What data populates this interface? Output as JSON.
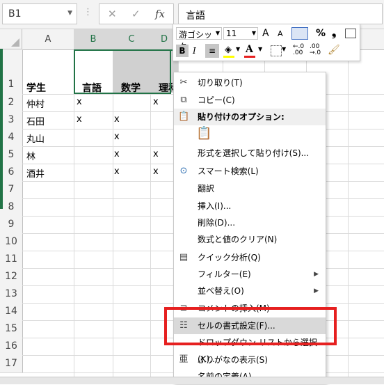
{
  "formula_bar": {
    "name_box": "B1",
    "dots": "⋮",
    "cancel_icon": "✕",
    "enter_icon": "✓",
    "fx_label": "fx",
    "content": "言語"
  },
  "columns": [
    "A",
    "B",
    "C",
    "D"
  ],
  "rows": [
    "1",
    "2",
    "3",
    "4",
    "5",
    "6",
    "7",
    "8",
    "9",
    "10",
    "11",
    "12",
    "13",
    "14",
    "15",
    "16",
    "17"
  ],
  "cells": {
    "A1": "学生",
    "B1": "言語",
    "C1": "数学",
    "D1": "理科",
    "A2": "仲村",
    "B2": "x",
    "D2": "x",
    "A3": "石田",
    "B3": "x",
    "C3": "x",
    "A4": "丸山",
    "C4": "x",
    "A5": "林",
    "C5": "x",
    "D5": "x",
    "A6": "酒井",
    "C6": "x",
    "D6": "x"
  },
  "mini_toolbar": {
    "font_name": "游ゴシック",
    "font_size": "11",
    "grow": "A",
    "shrink": "A",
    "percent": "%",
    "comma": "❟",
    "bold": "B",
    "italic": "I",
    "font_color_letter": "A",
    "inc_decimal": "←.0\n.00",
    "dec_decimal": ".00\n→.0",
    "fill_color": "#ffff00",
    "font_color": "#e62020"
  },
  "context_menu": {
    "cut": "切り取り(T)",
    "copy": "コピー(C)",
    "paste_options": "貼り付けのオプション:",
    "paste_special": "形式を選択して貼り付け(S)...",
    "smart_lookup": "スマート検索(L)",
    "translate": "翻訳",
    "insert": "挿入(I)...",
    "delete": "削除(D)...",
    "clear": "数式と値のクリア(N)",
    "quick_analysis": "クイック分析(Q)",
    "filter": "フィルター(E)",
    "sort": "並べ替え(O)",
    "insert_comment": "コメントの挿入(M)",
    "format_cells": "セルの書式設定(F)...",
    "pick_from_list": "ドロップダウン リストから選択(K)...",
    "show_furigana": "ふりがなの表示(S)",
    "define_name": "名前の定義(A)..."
  },
  "colors": {
    "accent": "#217346",
    "highlight_box": "#e62020"
  }
}
